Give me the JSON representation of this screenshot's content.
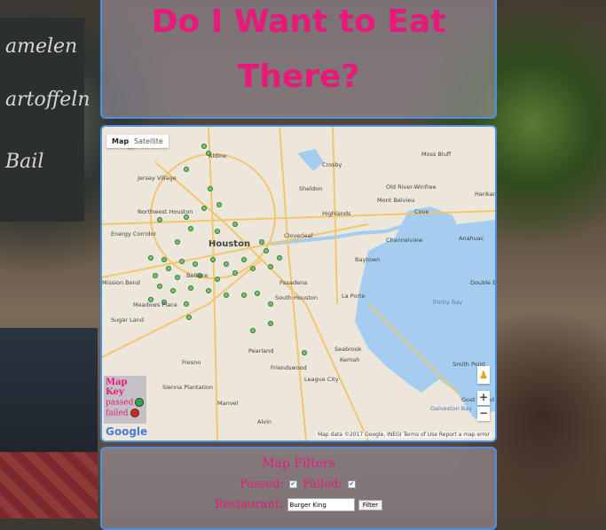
{
  "title": {
    "line1": "Do I Want to Eat",
    "line2": "There?"
  },
  "map": {
    "type_buttons": [
      "Map",
      "Satellite"
    ],
    "labels": [
      "Aldine",
      "Jersey Village",
      "Crosby",
      "Sheldon",
      "Old River-Winfree",
      "Mont Belvieu",
      "Highlands",
      "Cove",
      "Houston",
      "Cloverleaf",
      "Baytown",
      "Channelview",
      "Bellaire",
      "Pasadena",
      "South Houston",
      "Mission Bend",
      "Meadows Place",
      "Sugar Land",
      "Pearland",
      "La Porte",
      "Seabrook",
      "Kemah",
      "Friendswood",
      "League City",
      "Fresno",
      "Sienna Plantation",
      "Manvel",
      "Alvin",
      "Anahuac",
      "Smith Point",
      "Hankamer",
      "Moss Bluff",
      "Double Bayou",
      "Galveston Bay",
      "Trinity Bay",
      "Northwest Houston",
      "Energy Corridor",
      "Goat Island"
    ],
    "attribution": "Map data ©2017 Google, INEGI   Terms of Use   Report a map error",
    "google": "Google",
    "zoom_in": "+",
    "zoom_out": "−"
  },
  "map_key": {
    "title": "Map Key",
    "passed": "passed",
    "failed": "failed",
    "passed_color": "#2ea84a",
    "failed_color": "#e02020"
  },
  "filters": {
    "title": "Map Filters",
    "passed_label": "Passed:",
    "failed_label": "Failed:",
    "restaurant_label": "Restaurant:",
    "restaurant_value": "Burger King",
    "filter_button": "Filter"
  },
  "colors": {
    "accent": "#e8197b",
    "border": "#4a8fe0",
    "water": "#a4cdf0"
  }
}
